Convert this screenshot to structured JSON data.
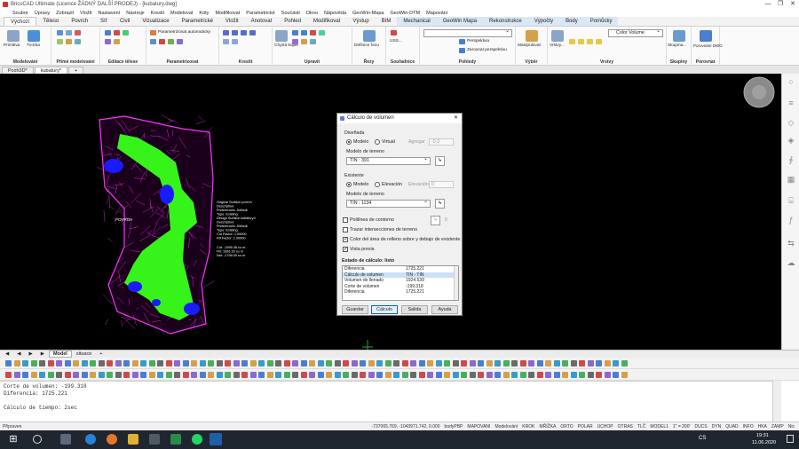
{
  "app": {
    "title": "BricsCAD Ultimate (Licence ŽÁDNÝ DALŠÍ PRODEJ) - [kubatury.dwg]",
    "win_min": "—",
    "win_max": "❐",
    "win_close": "✕"
  },
  "menu": [
    "Soubor",
    "Úpravy",
    "Zobrazit",
    "Vložit",
    "Nastavení",
    "Nástroje",
    "Kreslit",
    "Modelovat",
    "Kóty",
    "Modifikovat",
    "Parametrické",
    "Součásti",
    "Okno",
    "Nápověda",
    "GeoWin-Mapa",
    "GeoWin-DTM",
    "Mapování"
  ],
  "ribbon_tabs": [
    "Výchozí",
    "Těleso",
    "Povrch",
    "Síť",
    "Civil",
    "Vizualizace",
    "Parametrické",
    "Vložit",
    "Anotovat",
    "Pohled",
    "Modifikovat",
    "Výstup",
    "BIM",
    "Mechanical",
    "GeoWin Mapa",
    "Rekonstrukce",
    "Výpočty",
    "Body",
    "Pomůcky"
  ],
  "ribbon": {
    "groups": [
      "Modelování",
      "Přímé modelování",
      "Editace tělese",
      "Parametrizovat",
      "Kreslit",
      "Upravit",
      "Řezy",
      "Souřadnice",
      "Pohledy",
      "Výběr",
      "Vrstvy",
      "Skupiny",
      "Porovnat"
    ],
    "labels": {
      "primitiva": "Primitiva",
      "tvorba": "Tvorba",
      "param_auto": "Parametrizovat automaticky",
      "chytra_kopie": "Chytrá kopie",
      "definice_rezu": "Definice řezu",
      "uss": "USS...",
      "perspektiva": "Perspektiva",
      "zarovnat": "Zarovnat perspektivu",
      "manipulovat": "Manipulovat",
      "vrstvy": "Vrstvy...",
      "color_volume": "Color Volume",
      "skupina": "Skupina...",
      "porovnani": "Porovnání DWG"
    }
  },
  "doc_tabs": [
    "Pcoh3D*",
    "kubatury*",
    "+"
  ],
  "drawing": {
    "label_povrch": "POVRCH",
    "props": [
      "Original  Surface      povrch",
      "Description:",
      "Preferences:     Default",
      "Type:     Existing",
      "Design  Surface      kubatury4",
      "Description:",
      "Preferences:     Default",
      "Type:     Existing",
      "Cut Factor:     1.00000",
      "Fill Factor:     1.00000",
      "",
      "Cut:     -1995.36 cu m",
      "Fill:     1926.20 cu m",
      "Net:     -1796.00 cu m"
    ]
  },
  "dialog": {
    "title": "Cálculo de volumen",
    "close": "✕",
    "diseñada": "Diseñada",
    "modelo": "Modelo",
    "virtual": "Virtual",
    "agregar": "Agregar",
    "agregar_val": "-0.3",
    "modelo_terreno": "Modelo de terreno",
    "tin1": "TIN : 391",
    "existente": "Existente",
    "elevacion": "Elevación",
    "elevacion_val": "0",
    "tin2": "TIN : 1134",
    "polilinea": "Polilínea de contorno",
    "polilinea_val": "0",
    "trazar": "Trazar intersecciones de terreno",
    "color_relleno": "Color del área de relleno sobre y debajo de existente",
    "vista_previa": "Vista previa",
    "estado": "Estado de cálculo: listo",
    "rows": [
      {
        "k": "Diferencia",
        "v": "1725.221"
      },
      {
        "k": "Cálculo de volumen",
        "v": "TIN - TIN"
      },
      {
        "k": "Volumen de llenado",
        "v": "1924.539"
      },
      {
        "k": "Corte de volumen",
        "v": "-199.318"
      },
      {
        "k": "Diferencia",
        "v": "1725.221"
      }
    ],
    "selected_row": 1,
    "btn_guardar": "Guardar",
    "btn_calculo": "Cálculo",
    "btn_salida": "Salida",
    "btn_ayuda": "Ayuda"
  },
  "layout_tabs": [
    "Model",
    "situace",
    "+"
  ],
  "command": [
    "Corte de volumen: -199.318",
    "Diferencia: 1725.221",
    "",
    "Cálculo de tiempo: 2sec"
  ],
  "command_prompt": "Připraven",
  "status": {
    "coords": "-737065.769, -1043971.742, 0.000",
    "items": [
      "bodyPBP",
      "MAPOVANI",
      "Modelování",
      "KROK",
      "MŘÍŽKA",
      "ORTO",
      "POLAR",
      "UCHOP",
      "OTRAS",
      "TLČ",
      "MODEL1",
      "1\" = 200'",
      "DUCS",
      "DYN",
      "QUAD",
      "INFO",
      "HKA",
      "ZAMP",
      "Nic"
    ]
  },
  "taskbar": {
    "lang": "CS",
    "time": "19:31",
    "date": "11.06.2020"
  },
  "colors": {
    "green": "#36f31a",
    "magenta": "#ff30ff",
    "blue": "#1a1aff",
    "accent": "#0a64c8"
  }
}
